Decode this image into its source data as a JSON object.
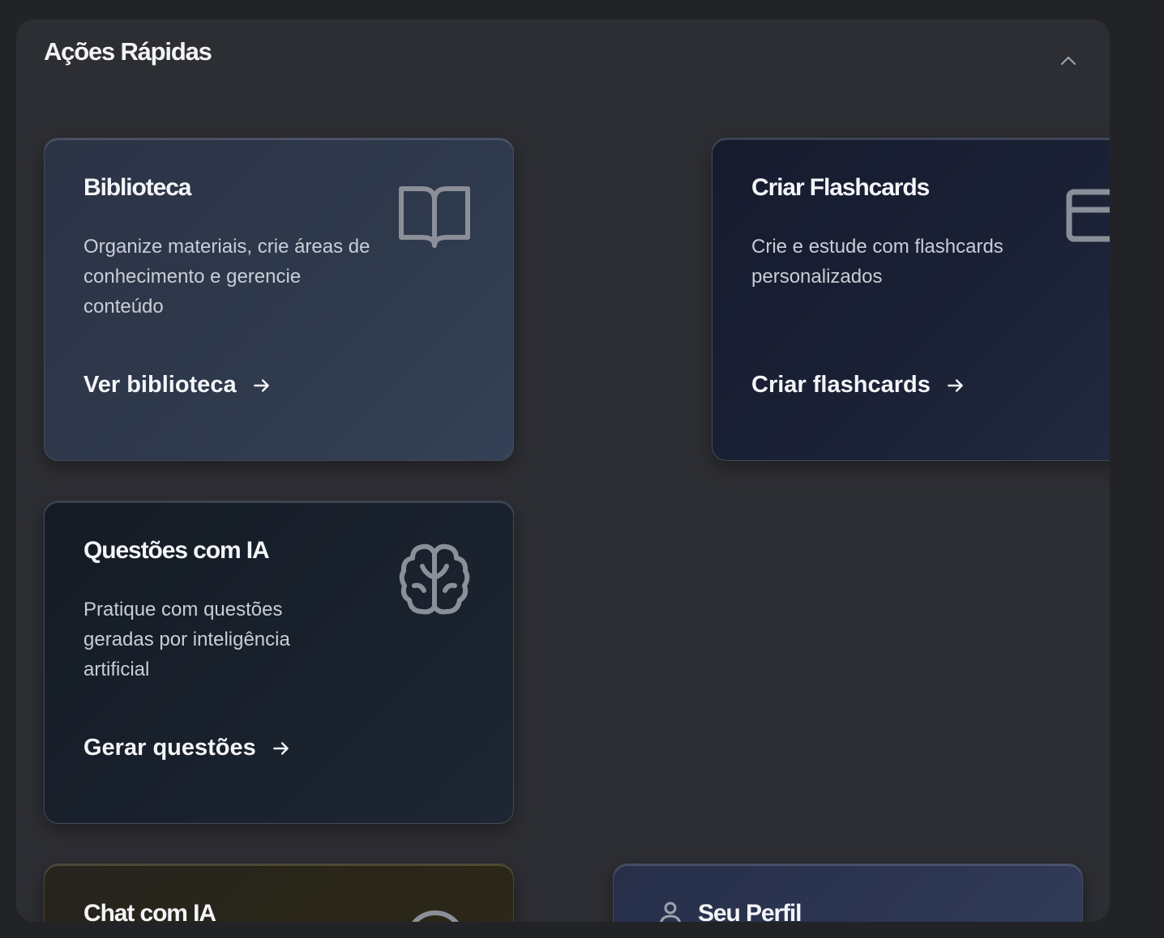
{
  "section": {
    "title": "Ações Rápidas",
    "collapse_icon": "chevron-up-icon"
  },
  "cards": {
    "biblioteca": {
      "title": "Biblioteca",
      "description": "Organize materiais, crie áreas de conhecimento e gerencie conteúdo",
      "link": "Ver biblioteca",
      "icon": "book-open-icon"
    },
    "flashcards": {
      "title": "Criar Flashcards",
      "description": "Crie e estude com flashcards personalizados",
      "link": "Criar flashcards",
      "icon": "cards-icon"
    },
    "questoes": {
      "title": "Questões com IA",
      "description": "Pratique com questões geradas por inteligência artificial",
      "link": "Gerar questões",
      "icon": "brain-icon"
    },
    "chat": {
      "title": "Chat com IA",
      "icon": "chat-icon"
    },
    "perfil": {
      "title": "Seu Perfil",
      "icon": "user-icon"
    }
  },
  "colors": {
    "page_background": "#222327",
    "panel_background": "#2d2e33",
    "icon_gray": "#8b8f98",
    "text_primary": "#f4f5f8",
    "text_secondary": "#c9cdd6"
  }
}
